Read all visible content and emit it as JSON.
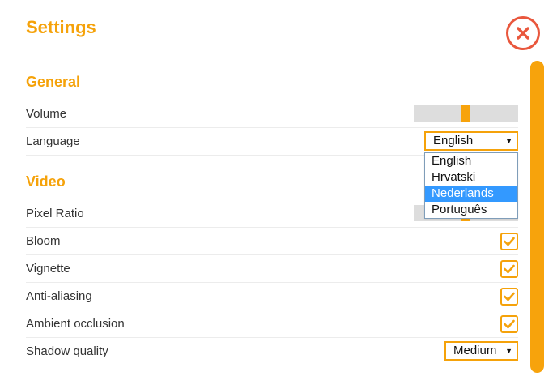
{
  "title": "Settings",
  "sections": {
    "general": {
      "title": "General",
      "volume": {
        "label": "Volume",
        "value_fraction": 0.5
      },
      "language": {
        "label": "Language",
        "selected": "English",
        "options": [
          "English",
          "Hrvatski",
          "Nederlands",
          "Português"
        ],
        "highlighted": "Nederlands"
      }
    },
    "video": {
      "title": "Video",
      "pixel_ratio": {
        "label": "Pixel Ratio"
      },
      "bloom": {
        "label": "Bloom",
        "checked": true
      },
      "vignette": {
        "label": "Vignette",
        "checked": true
      },
      "anti_aliasing": {
        "label": "Anti-aliasing",
        "checked": true
      },
      "ambient_occlusion": {
        "label": "Ambient occlusion",
        "checked": true
      },
      "shadow_quality": {
        "label": "Shadow quality",
        "selected": "Medium"
      }
    }
  },
  "colors": {
    "accent": "#f5a20a",
    "close": "#e9573d",
    "highlight": "#3399ff",
    "slider_track": "#dddddd"
  },
  "icons": {
    "close": "close-icon",
    "check": "check-icon",
    "dropdown_arrow": "triangle-down-icon"
  }
}
